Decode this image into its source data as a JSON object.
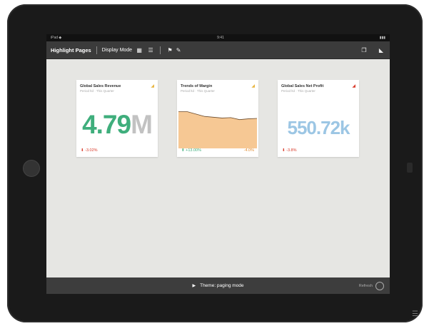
{
  "statusbar": {
    "left": "iPad ◆",
    "center": "9:41",
    "right": "▮▮▮"
  },
  "toolbar": {
    "title": "Highlight Pages",
    "mode_label": "Display Mode",
    "grid_glyph": "▦",
    "list_glyph": "☰",
    "filter_glyph": "⚑",
    "edit_glyph": "✎",
    "doc_glyph": "❐",
    "feed_glyph": "◣"
  },
  "cards": [
    {
      "title": "Global Sales Revenue",
      "subtitle": "Period ltd · This Quarter",
      "value_main": "4.79",
      "value_suffix": "M",
      "trend_glyph": "⬇",
      "change": "-3.02%",
      "right": "",
      "flag": "◢"
    },
    {
      "title": "Trends of Margin",
      "subtitle": "Period ltd · This Quarter",
      "trend_glyph": "⬆",
      "change": "+13.00%",
      "right": "-4.0%",
      "flag": "◢"
    },
    {
      "title": "Global Sales Net Profit",
      "subtitle": "Period ltd · This Quarter",
      "value_main": "550.72k",
      "trend_glyph": "⬇",
      "change": "-3.8%",
      "right": "",
      "flag": "◢"
    }
  ],
  "bottombar": {
    "play": "▶",
    "caption": "Theme: paging mode",
    "right_label": "Refresh"
  },
  "colors": {
    "green": "#3fae7c",
    "blue": "#9cc6e4",
    "gray_suffix": "#c2c2c2",
    "area": "#f6c894",
    "red": "#d93a2a"
  },
  "chart_data": {
    "type": "area",
    "x": [
      0,
      1,
      2,
      3,
      4,
      5,
      6,
      7,
      8,
      9
    ],
    "series": [
      {
        "values": [
          0.92,
          0.92,
          0.86,
          0.8,
          0.78,
          0.76,
          0.77,
          0.72,
          0.74,
          0.75
        ]
      }
    ],
    "ylim": [
      0,
      1
    ]
  }
}
